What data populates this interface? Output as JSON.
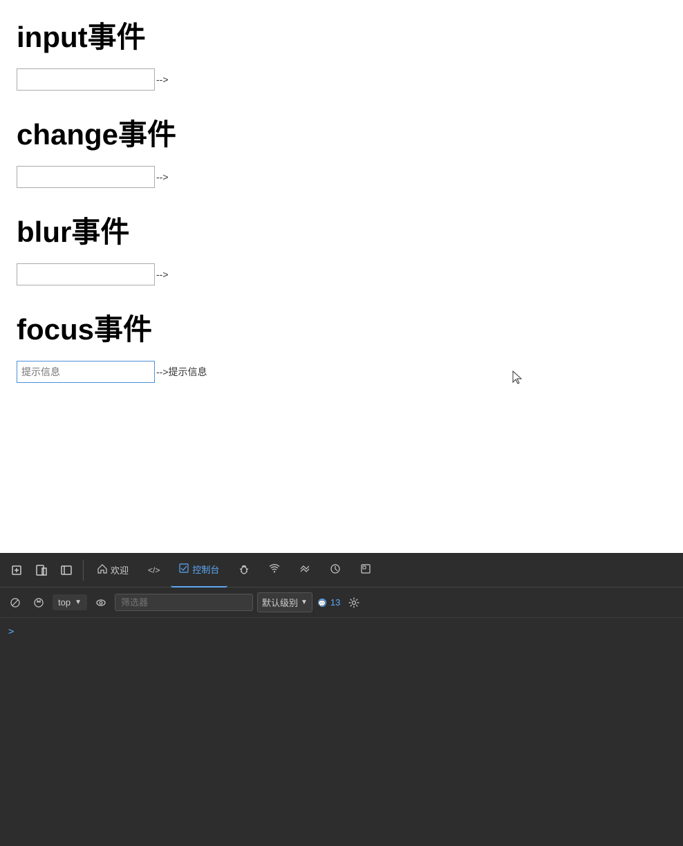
{
  "content": {
    "sections": [
      {
        "id": "input-section",
        "title": "input事件",
        "input_placeholder": "",
        "input_value": "",
        "arrow": "-->"
      },
      {
        "id": "change-section",
        "title": "change事件",
        "input_placeholder": "",
        "input_value": "",
        "arrow": "-->"
      },
      {
        "id": "blur-section",
        "title": "blur事件",
        "input_placeholder": "",
        "input_value": "",
        "arrow": "-->"
      },
      {
        "id": "focus-section",
        "title": "focus事件",
        "input_placeholder": "提示信息",
        "input_value": "",
        "arrow": "-->提示信息"
      }
    ]
  },
  "devtools": {
    "tabs": [
      {
        "id": "select",
        "icon": "⬚",
        "label": "",
        "active": false
      },
      {
        "id": "inspect",
        "icon": "⊡",
        "label": "",
        "active": false
      },
      {
        "id": "sidebar",
        "icon": "▣",
        "label": "",
        "active": false
      },
      {
        "id": "welcome",
        "icon": "⌂",
        "label": "欢迎",
        "active": false
      },
      {
        "id": "source",
        "icon": "</>",
        "label": "",
        "active": false
      },
      {
        "id": "console",
        "icon": "▶",
        "label": "控制台",
        "active": true
      },
      {
        "id": "debugger",
        "icon": "🐛",
        "label": "",
        "active": false
      },
      {
        "id": "network",
        "icon": "((·))",
        "label": "",
        "active": false
      },
      {
        "id": "performance",
        "icon": "⇌",
        "label": "",
        "active": false
      },
      {
        "id": "memory",
        "icon": "⚙",
        "label": "",
        "active": false
      },
      {
        "id": "application",
        "icon": "▭",
        "label": "",
        "active": false
      }
    ],
    "console": {
      "filter_placeholder": "筛选器",
      "level_label": "默认级别",
      "message_count": "13",
      "settings_icon": "⚙",
      "prompt_caret": ">",
      "toolbar_buttons": [
        {
          "id": "clear",
          "icon": "⊘",
          "label": ""
        },
        {
          "id": "preserve",
          "icon": "⊗",
          "label": ""
        },
        {
          "id": "context-selector",
          "value": "top",
          "dropdown": true
        },
        {
          "id": "eye",
          "icon": "◉",
          "label": ""
        }
      ]
    }
  }
}
